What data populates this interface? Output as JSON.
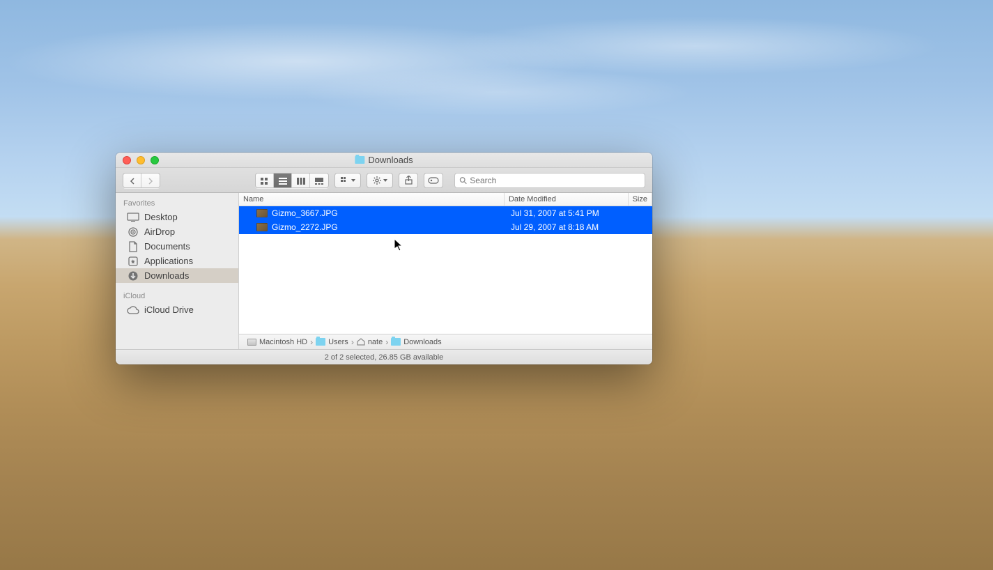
{
  "window": {
    "title": "Downloads"
  },
  "toolbar": {
    "search_placeholder": "Search"
  },
  "sidebar": {
    "sections": {
      "favorites": {
        "title": "Favorites",
        "items": [
          {
            "label": "Desktop"
          },
          {
            "label": "AirDrop"
          },
          {
            "label": "Documents"
          },
          {
            "label": "Applications"
          },
          {
            "label": "Downloads"
          }
        ]
      },
      "icloud": {
        "title": "iCloud",
        "items": [
          {
            "label": "iCloud Drive"
          }
        ]
      }
    }
  },
  "columns": {
    "name": "Name",
    "date": "Date Modified",
    "size": "Size"
  },
  "files": [
    {
      "name": "Gizmo_3667.JPG",
      "date": "Jul 31, 2007 at 5:41 PM"
    },
    {
      "name": "Gizmo_2272.JPG",
      "date": "Jul 29, 2007 at 8:18 AM"
    }
  ],
  "pathbar": {
    "segments": [
      {
        "label": "Macintosh HD"
      },
      {
        "label": "Users"
      },
      {
        "label": "nate"
      },
      {
        "label": "Downloads"
      }
    ]
  },
  "statusbar": {
    "text": "2 of 2 selected, 26.85 GB available"
  }
}
